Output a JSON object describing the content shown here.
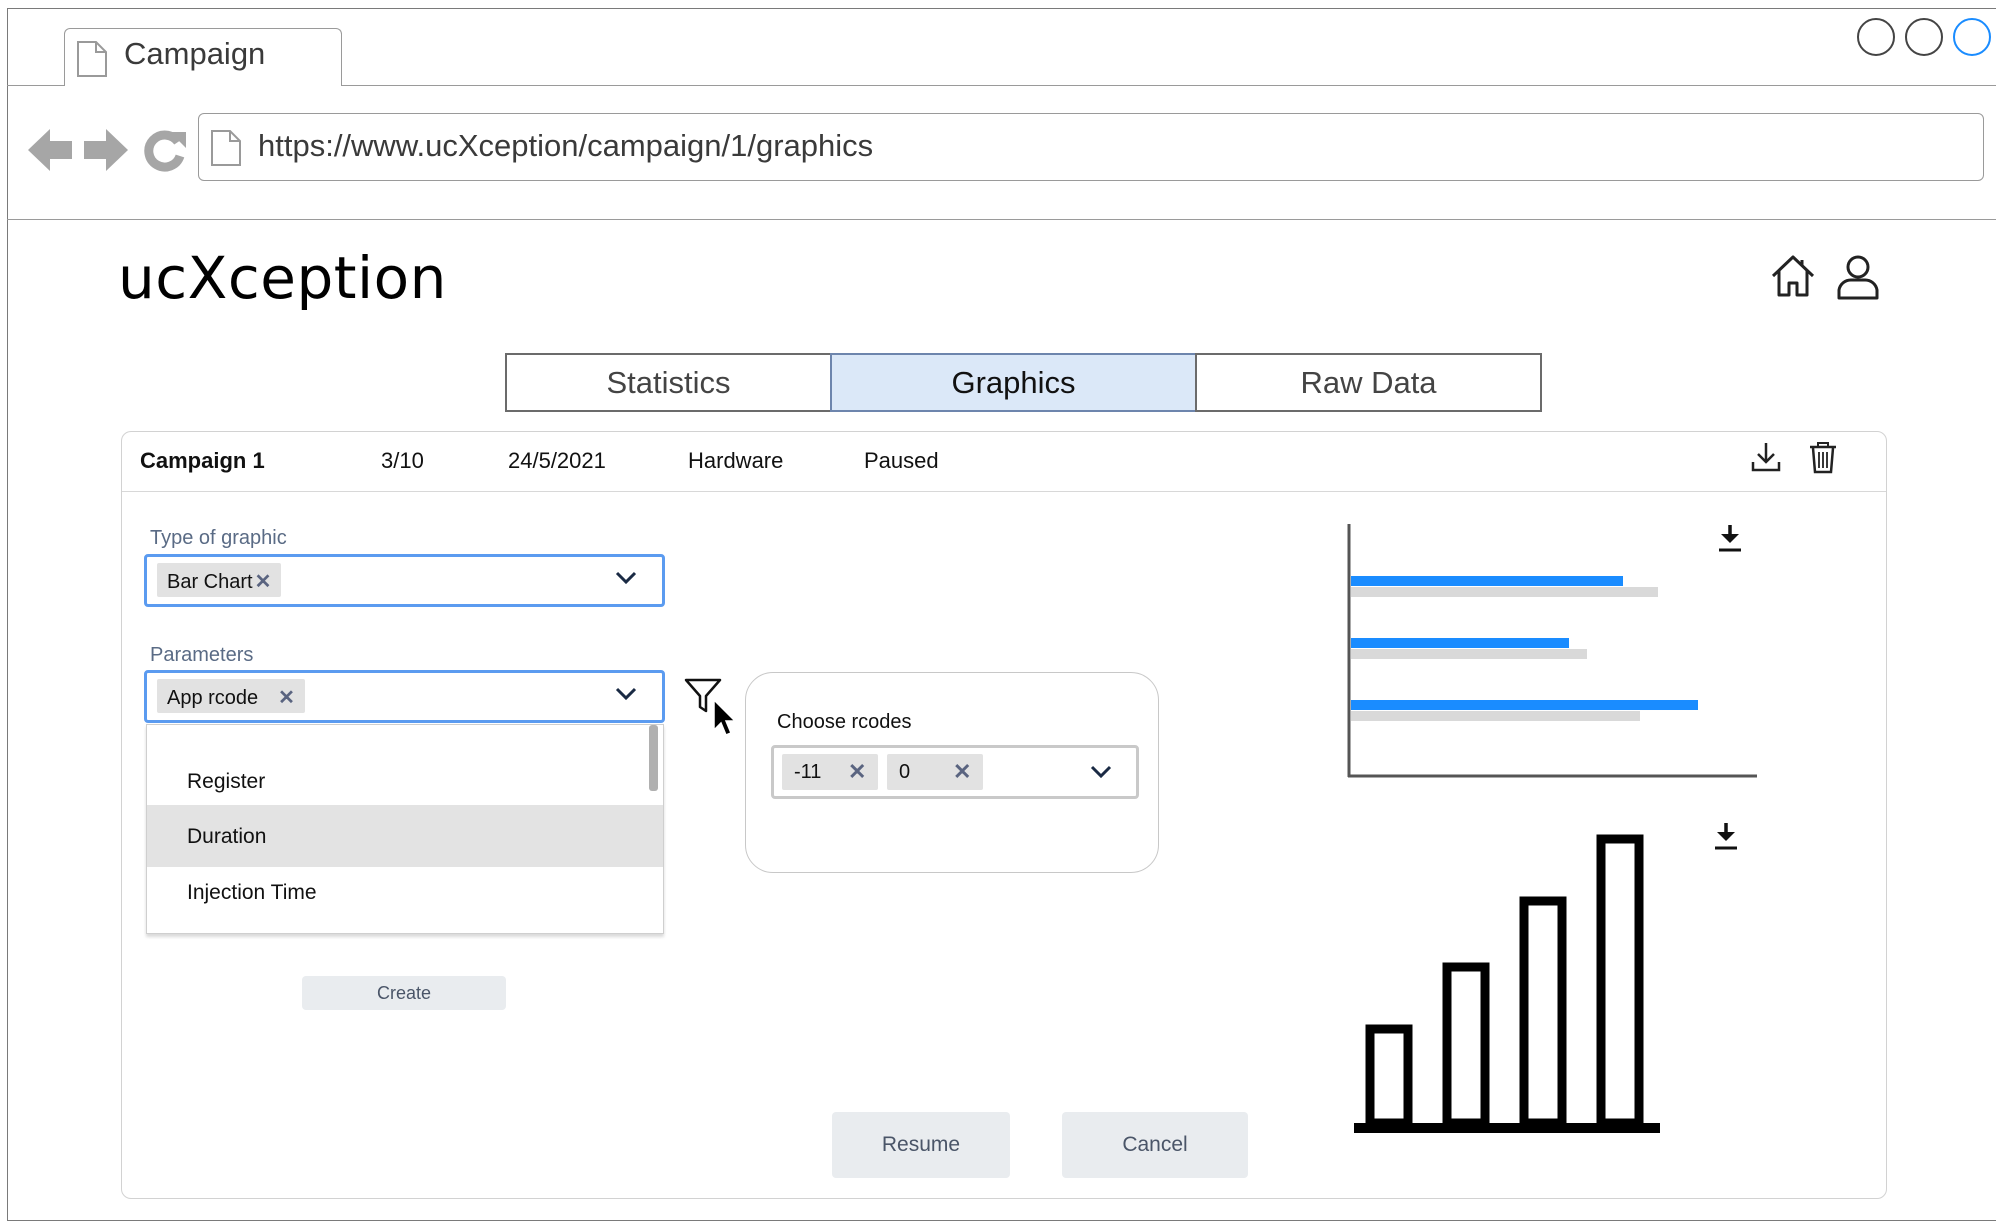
{
  "browser": {
    "tab_title": "Campaign",
    "url": "https://www.ucXception/campaign/1/graphics"
  },
  "app": {
    "logo": "ucXception"
  },
  "tabs": [
    {
      "label": "Statistics",
      "active": false
    },
    {
      "label": "Graphics",
      "active": true
    },
    {
      "label": "Raw Data",
      "active": false
    }
  ],
  "campaign": {
    "name": "Campaign 1",
    "progress": "3/10",
    "date": "24/5/2021",
    "type": "Hardware",
    "status": "Paused"
  },
  "form": {
    "graphic_type": {
      "label": "Type of graphic",
      "selected": "Bar Chart"
    },
    "parameters": {
      "label": "Parameters",
      "selected": "App rcode",
      "options": [
        "Register",
        "Duration",
        "Injection Time"
      ],
      "highlighted": "Duration"
    },
    "create_label": "Create"
  },
  "rcodes": {
    "label": "Choose rcodes",
    "chips": [
      "-11",
      "0"
    ]
  },
  "actions": {
    "resume": "Resume",
    "cancel": "Cancel"
  },
  "colors": {
    "accent": "#1a8cff",
    "active_tab": "#dbe8f8",
    "select_border": "#5b9bf0",
    "bar_secondary": "#d9d9d9"
  },
  "chart_data": [
    {
      "type": "bar",
      "orientation": "horizontal",
      "series": [
        {
          "values": [
            0.76,
            0.61,
            0.97
          ]
        },
        {
          "values": [
            0.86,
            0.66,
            0.81
          ]
        }
      ]
    },
    {
      "type": "bar",
      "values": [
        0.33,
        0.55,
        0.78,
        1.0
      ]
    }
  ]
}
